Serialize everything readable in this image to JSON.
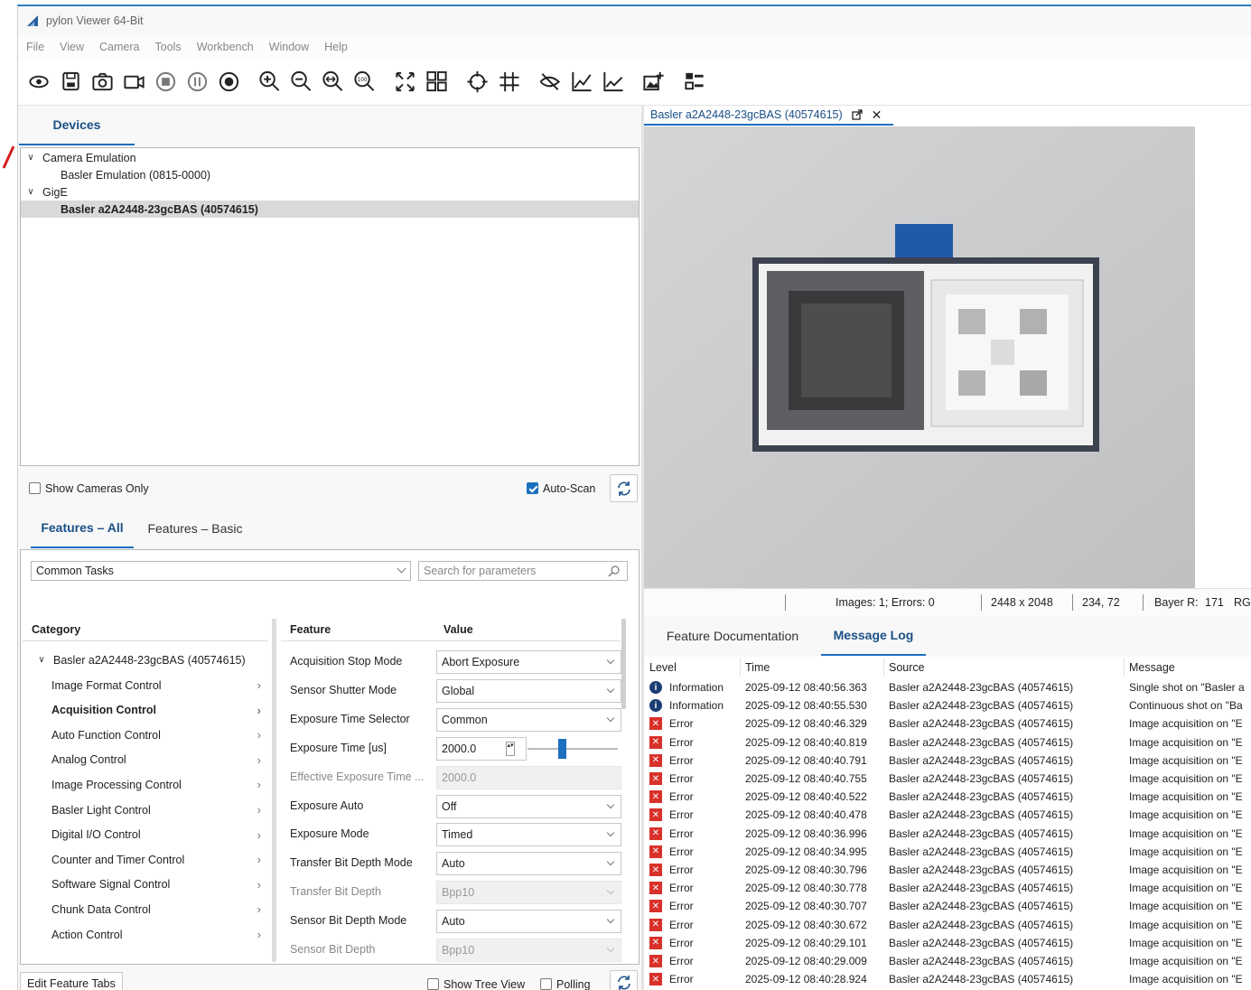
{
  "window": {
    "title": "pylon Viewer 64-Bit"
  },
  "menu": [
    "File",
    "View",
    "Camera",
    "Tools",
    "Workbench",
    "Window",
    "Help"
  ],
  "toolbar_icons": [
    "continuous-shot-icon",
    "save-icon",
    "single-shot-icon",
    "record-video-icon",
    "stop-icon",
    "pause-icon",
    "record-icon",
    "zoom-in-icon",
    "zoom-out-icon",
    "zoom-fit-icon",
    "zoom-100-icon",
    "fullscreen-icon",
    "layout-grid-icon",
    "crosshair-icon",
    "grid-overlay-icon",
    "hide-overlay-icon",
    "histogram-icon",
    "line-profile-icon",
    "add-image-icon",
    "device-list-icon"
  ],
  "devices": {
    "tab": "Devices",
    "tree": [
      {
        "label": "Camera Emulation",
        "level": 0,
        "expanded": true
      },
      {
        "label": "Basler Emulation (0815-0000)",
        "level": 1
      },
      {
        "label": "GigE",
        "level": 0,
        "expanded": true
      },
      {
        "label": "Basler a2A2448-23gcBAS (40574615)",
        "level": 1,
        "selected": true
      }
    ],
    "show_cameras_only": "Show Cameras Only",
    "auto_scan": "Auto-Scan"
  },
  "features": {
    "tabs": [
      "Features – All",
      "Features – Basic"
    ],
    "task_combo": "Common Tasks",
    "search_placeholder": "Search for parameters",
    "col_category": "Category",
    "col_feature": "Feature",
    "col_value": "Value",
    "root": "Basler a2A2448-23gcBAS (40574615)",
    "categories": [
      "Image Format Control",
      "Acquisition Control",
      "Auto Function Control",
      "Analog Control",
      "Image Processing Control",
      "Basler Light Control",
      "Digital I/O Control",
      "Counter and Timer Control",
      "Software Signal Control",
      "Chunk Data Control",
      "Action Control"
    ],
    "selected_category": "Acquisition Control",
    "rows": [
      {
        "name": "Acquisition Stop Mode",
        "value": "Abort Exposure",
        "disabled": false
      },
      {
        "name": "Sensor Shutter Mode",
        "value": "Global",
        "disabled": false
      },
      {
        "name": "Exposure Time Selector",
        "value": "Common",
        "disabled": false
      },
      {
        "name": "Exposure Time [us]",
        "value": "2000.0",
        "disabled": false
      },
      {
        "name": "Effective Exposure Time ...",
        "value": "2000.0",
        "disabled": true
      },
      {
        "name": "Exposure Auto",
        "value": "Off",
        "disabled": false
      },
      {
        "name": "Exposure Mode",
        "value": "Timed",
        "disabled": false
      },
      {
        "name": "Transfer Bit Depth Mode",
        "value": "Auto",
        "disabled": false
      },
      {
        "name": "Transfer Bit Depth",
        "value": "Bpp10",
        "disabled": true
      },
      {
        "name": "Sensor Bit Depth Mode",
        "value": "Auto",
        "disabled": false
      },
      {
        "name": "Sensor Bit Depth",
        "value": "Bpp10",
        "disabled": true
      }
    ],
    "edit_tabs": "Edit Feature Tabs",
    "show_tree_view": "Show Tree View",
    "polling": "Polling"
  },
  "viewer": {
    "tab": "Basler a2A2448-23gcBAS (40574615)",
    "status": {
      "images": "Images: 1; Errors: 0",
      "resolution": "2448 x 2048",
      "position": "234, 72",
      "bayer_label": "Bayer R:",
      "bayer_value": "171",
      "extra": "RG"
    }
  },
  "log": {
    "tabs": [
      "Feature Documentation",
      "Message Log"
    ],
    "headers": [
      "Level",
      "Time",
      "Source",
      "Message"
    ],
    "rows": [
      {
        "level": "Information",
        "type": "info",
        "time": "2025-09-12 08:40:56.363",
        "source": "Basler a2A2448-23gcBAS (40574615)",
        "message": "Single shot on \"Basler a"
      },
      {
        "level": "Information",
        "type": "info",
        "time": "2025-09-12 08:40:55.530",
        "source": "Basler a2A2448-23gcBAS (40574615)",
        "message": "Continuous shot on \"Ba"
      },
      {
        "level": "Error",
        "type": "err",
        "time": "2025-09-12 08:40:46.329",
        "source": "Basler a2A2448-23gcBAS (40574615)",
        "message": "Image acquisition on \"E"
      },
      {
        "level": "Error",
        "type": "err",
        "time": "2025-09-12 08:40:40.819",
        "source": "Basler a2A2448-23gcBAS (40574615)",
        "message": "Image acquisition on \"E"
      },
      {
        "level": "Error",
        "type": "err",
        "time": "2025-09-12 08:40:40.791",
        "source": "Basler a2A2448-23gcBAS (40574615)",
        "message": "Image acquisition on \"E"
      },
      {
        "level": "Error",
        "type": "err",
        "time": "2025-09-12 08:40:40.755",
        "source": "Basler a2A2448-23gcBAS (40574615)",
        "message": "Image acquisition on \"E"
      },
      {
        "level": "Error",
        "type": "err",
        "time": "2025-09-12 08:40:40.522",
        "source": "Basler a2A2448-23gcBAS (40574615)",
        "message": "Image acquisition on \"E"
      },
      {
        "level": "Error",
        "type": "err",
        "time": "2025-09-12 08:40:40.478",
        "source": "Basler a2A2448-23gcBAS (40574615)",
        "message": "Image acquisition on \"E"
      },
      {
        "level": "Error",
        "type": "err",
        "time": "2025-09-12 08:40:36.996",
        "source": "Basler a2A2448-23gcBAS (40574615)",
        "message": "Image acquisition on \"E"
      },
      {
        "level": "Error",
        "type": "err",
        "time": "2025-09-12 08:40:34.995",
        "source": "Basler a2A2448-23gcBAS (40574615)",
        "message": "Image acquisition on \"E"
      },
      {
        "level": "Error",
        "type": "err",
        "time": "2025-09-12 08:40:30.796",
        "source": "Basler a2A2448-23gcBAS (40574615)",
        "message": "Image acquisition on \"E"
      },
      {
        "level": "Error",
        "type": "err",
        "time": "2025-09-12 08:40:30.778",
        "source": "Basler a2A2448-23gcBAS (40574615)",
        "message": "Image acquisition on \"E"
      },
      {
        "level": "Error",
        "type": "err",
        "time": "2025-09-12 08:40:30.707",
        "source": "Basler a2A2448-23gcBAS (40574615)",
        "message": "Image acquisition on \"E"
      },
      {
        "level": "Error",
        "type": "err",
        "time": "2025-09-12 08:40:30.672",
        "source": "Basler a2A2448-23gcBAS (40574615)",
        "message": "Image acquisition on \"E"
      },
      {
        "level": "Error",
        "type": "err",
        "time": "2025-09-12 08:40:29.101",
        "source": "Basler a2A2448-23gcBAS (40574615)",
        "message": "Image acquisition on \"E"
      },
      {
        "level": "Error",
        "type": "err",
        "time": "2025-09-12 08:40:29.009",
        "source": "Basler a2A2448-23gcBAS (40574615)",
        "message": "Image acquisition on \"E"
      },
      {
        "level": "Error",
        "type": "err",
        "time": "2025-09-12 08:40:28.924",
        "source": "Basler a2A2448-23gcBAS (40574615)",
        "message": "Image acquisition on \"E"
      }
    ]
  },
  "colors": {
    "accent": "#1d6fbf",
    "error": "#d9312b",
    "info": "#1a3d73",
    "title_border": "#2b7dc0"
  }
}
